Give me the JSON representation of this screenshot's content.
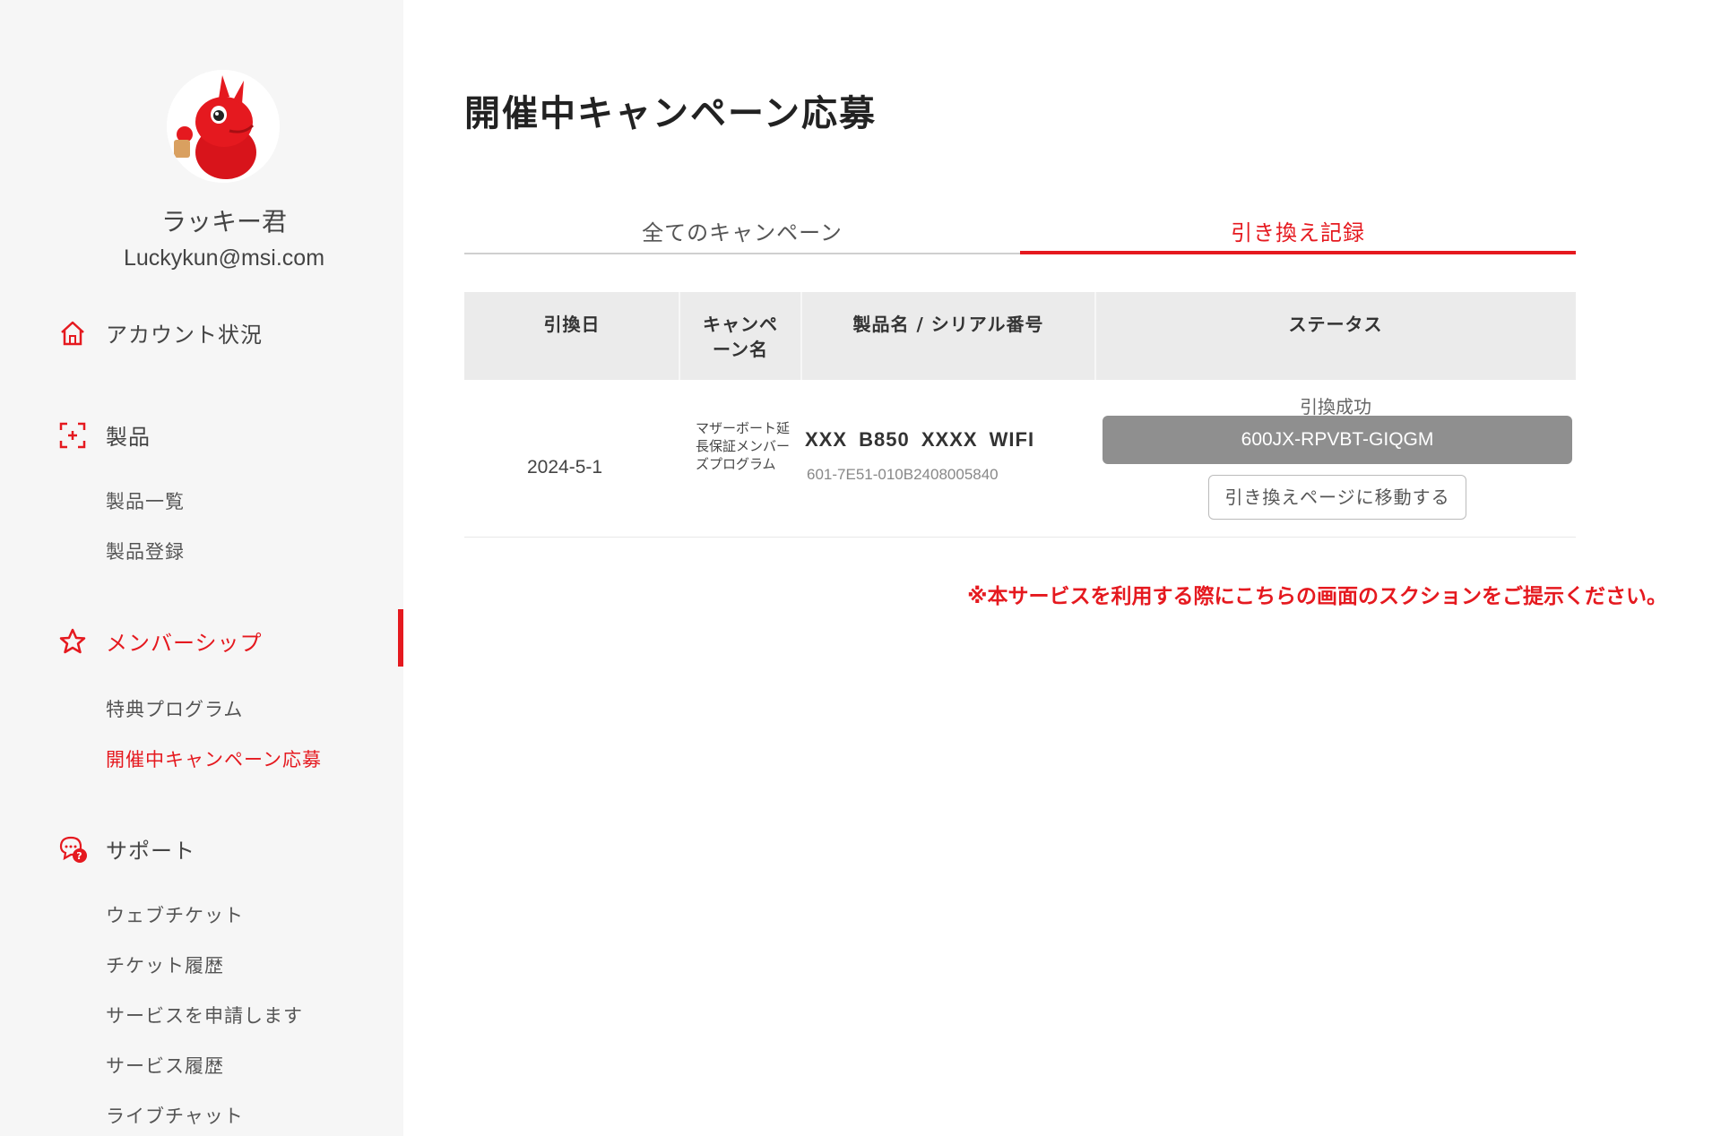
{
  "user": {
    "name": "ラッキー君",
    "email": "Luckykun@msi.com"
  },
  "sidebar": {
    "account": "アカウント状況",
    "products": {
      "label": "製品",
      "items": [
        "製品一覧",
        "製品登録"
      ]
    },
    "membership": {
      "label": "メンバーシップ",
      "items": [
        "特典プログラム",
        "開催中キャンペーン応募"
      ]
    },
    "support": {
      "label": "サポート",
      "items": [
        "ウェブチケット",
        "チケット履歴",
        "サービスを申請します",
        "サービス履歴",
        "ライブチャット"
      ]
    }
  },
  "page": {
    "title": "開催中キャンペーン応募"
  },
  "tabs": [
    "全てのキャンペーン",
    "引き換え記録"
  ],
  "table": {
    "headers": [
      "引換日",
      "キャンペーン名",
      "製品名 / シリアル番号",
      "ステータス"
    ],
    "rows": [
      {
        "date": "2024-5-1",
        "campaign": "マザーボート延長保証メンバーズプログラム",
        "product": "XXX B850 XXXX WIFI",
        "serial": "601-7E51-010B2408005840",
        "status": "引換成功",
        "code": "600JX-RPVBT-GIQGM",
        "action": "引き換えページに移動する"
      }
    ]
  },
  "notice": "※本サービスを利用する際にこちらの画面のスクションをご提示ください。",
  "colors": {
    "accent": "#e5191f",
    "sidebar_bg": "#f6f6f6",
    "header_bg": "#ebebeb",
    "code_bg": "#8f8f8f"
  }
}
